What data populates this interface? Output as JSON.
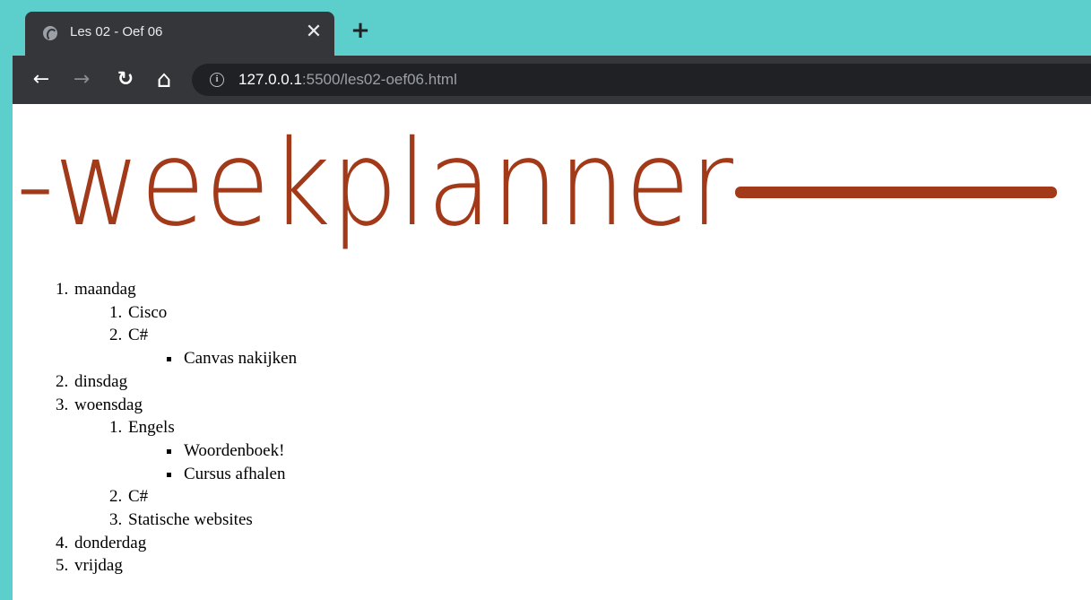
{
  "browser": {
    "tab_title": "Les 02 - Oef 06",
    "tab_close": "✕",
    "new_tab": "+",
    "url_host": "127.0.0.1",
    "url_rest": ":5500/les02-oef06.html"
  },
  "toolbar": {
    "back": "←",
    "forward": "→",
    "reload": "↻",
    "home": "⌂",
    "info": "i"
  },
  "page": {
    "heading": "-weekplanner",
    "heading_color": "#a23a1a",
    "days": [
      {
        "label": "maandag",
        "subjects": [
          {
            "label": "Cisco",
            "tasks": []
          },
          {
            "label": "C#",
            "tasks": [
              "Canvas nakijken"
            ]
          }
        ]
      },
      {
        "label": "dinsdag",
        "subjects": []
      },
      {
        "label": "woensdag",
        "subjects": [
          {
            "label": "Engels",
            "tasks": [
              "Woordenboek!",
              "Cursus afhalen"
            ]
          },
          {
            "label": "C#",
            "tasks": []
          },
          {
            "label": "Statische websites",
            "tasks": []
          }
        ]
      },
      {
        "label": "donderdag",
        "subjects": []
      },
      {
        "label": "vrijdag",
        "subjects": []
      }
    ]
  },
  "colors": {
    "tabstrip": "#5ccfcd",
    "toolbar": "#35363a",
    "omnibox": "#202124"
  }
}
